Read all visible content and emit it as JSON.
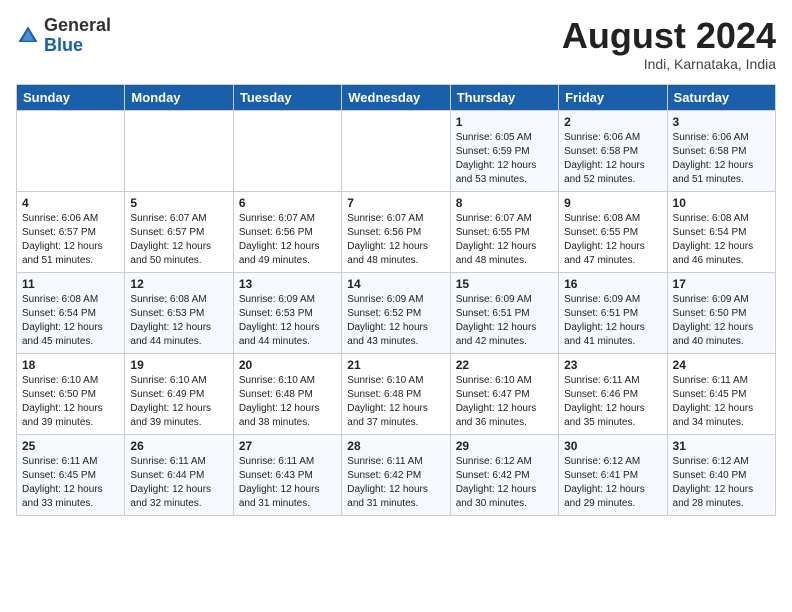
{
  "header": {
    "logo_general": "General",
    "logo_blue": "Blue",
    "month_year": "August 2024",
    "location": "Indi, Karnataka, India"
  },
  "days_of_week": [
    "Sunday",
    "Monday",
    "Tuesday",
    "Wednesday",
    "Thursday",
    "Friday",
    "Saturday"
  ],
  "weeks": [
    [
      {
        "day": "",
        "content": ""
      },
      {
        "day": "",
        "content": ""
      },
      {
        "day": "",
        "content": ""
      },
      {
        "day": "",
        "content": ""
      },
      {
        "day": "1",
        "content": "Sunrise: 6:05 AM\nSunset: 6:59 PM\nDaylight: 12 hours\nand 53 minutes."
      },
      {
        "day": "2",
        "content": "Sunrise: 6:06 AM\nSunset: 6:58 PM\nDaylight: 12 hours\nand 52 minutes."
      },
      {
        "day": "3",
        "content": "Sunrise: 6:06 AM\nSunset: 6:58 PM\nDaylight: 12 hours\nand 51 minutes."
      }
    ],
    [
      {
        "day": "4",
        "content": "Sunrise: 6:06 AM\nSunset: 6:57 PM\nDaylight: 12 hours\nand 51 minutes."
      },
      {
        "day": "5",
        "content": "Sunrise: 6:07 AM\nSunset: 6:57 PM\nDaylight: 12 hours\nand 50 minutes."
      },
      {
        "day": "6",
        "content": "Sunrise: 6:07 AM\nSunset: 6:56 PM\nDaylight: 12 hours\nand 49 minutes."
      },
      {
        "day": "7",
        "content": "Sunrise: 6:07 AM\nSunset: 6:56 PM\nDaylight: 12 hours\nand 48 minutes."
      },
      {
        "day": "8",
        "content": "Sunrise: 6:07 AM\nSunset: 6:55 PM\nDaylight: 12 hours\nand 48 minutes."
      },
      {
        "day": "9",
        "content": "Sunrise: 6:08 AM\nSunset: 6:55 PM\nDaylight: 12 hours\nand 47 minutes."
      },
      {
        "day": "10",
        "content": "Sunrise: 6:08 AM\nSunset: 6:54 PM\nDaylight: 12 hours\nand 46 minutes."
      }
    ],
    [
      {
        "day": "11",
        "content": "Sunrise: 6:08 AM\nSunset: 6:54 PM\nDaylight: 12 hours\nand 45 minutes."
      },
      {
        "day": "12",
        "content": "Sunrise: 6:08 AM\nSunset: 6:53 PM\nDaylight: 12 hours\nand 44 minutes."
      },
      {
        "day": "13",
        "content": "Sunrise: 6:09 AM\nSunset: 6:53 PM\nDaylight: 12 hours\nand 44 minutes."
      },
      {
        "day": "14",
        "content": "Sunrise: 6:09 AM\nSunset: 6:52 PM\nDaylight: 12 hours\nand 43 minutes."
      },
      {
        "day": "15",
        "content": "Sunrise: 6:09 AM\nSunset: 6:51 PM\nDaylight: 12 hours\nand 42 minutes."
      },
      {
        "day": "16",
        "content": "Sunrise: 6:09 AM\nSunset: 6:51 PM\nDaylight: 12 hours\nand 41 minutes."
      },
      {
        "day": "17",
        "content": "Sunrise: 6:09 AM\nSunset: 6:50 PM\nDaylight: 12 hours\nand 40 minutes."
      }
    ],
    [
      {
        "day": "18",
        "content": "Sunrise: 6:10 AM\nSunset: 6:50 PM\nDaylight: 12 hours\nand 39 minutes."
      },
      {
        "day": "19",
        "content": "Sunrise: 6:10 AM\nSunset: 6:49 PM\nDaylight: 12 hours\nand 39 minutes."
      },
      {
        "day": "20",
        "content": "Sunrise: 6:10 AM\nSunset: 6:48 PM\nDaylight: 12 hours\nand 38 minutes."
      },
      {
        "day": "21",
        "content": "Sunrise: 6:10 AM\nSunset: 6:48 PM\nDaylight: 12 hours\nand 37 minutes."
      },
      {
        "day": "22",
        "content": "Sunrise: 6:10 AM\nSunset: 6:47 PM\nDaylight: 12 hours\nand 36 minutes."
      },
      {
        "day": "23",
        "content": "Sunrise: 6:11 AM\nSunset: 6:46 PM\nDaylight: 12 hours\nand 35 minutes."
      },
      {
        "day": "24",
        "content": "Sunrise: 6:11 AM\nSunset: 6:45 PM\nDaylight: 12 hours\nand 34 minutes."
      }
    ],
    [
      {
        "day": "25",
        "content": "Sunrise: 6:11 AM\nSunset: 6:45 PM\nDaylight: 12 hours\nand 33 minutes."
      },
      {
        "day": "26",
        "content": "Sunrise: 6:11 AM\nSunset: 6:44 PM\nDaylight: 12 hours\nand 32 minutes."
      },
      {
        "day": "27",
        "content": "Sunrise: 6:11 AM\nSunset: 6:43 PM\nDaylight: 12 hours\nand 31 minutes."
      },
      {
        "day": "28",
        "content": "Sunrise: 6:11 AM\nSunset: 6:42 PM\nDaylight: 12 hours\nand 31 minutes."
      },
      {
        "day": "29",
        "content": "Sunrise: 6:12 AM\nSunset: 6:42 PM\nDaylight: 12 hours\nand 30 minutes."
      },
      {
        "day": "30",
        "content": "Sunrise: 6:12 AM\nSunset: 6:41 PM\nDaylight: 12 hours\nand 29 minutes."
      },
      {
        "day": "31",
        "content": "Sunrise: 6:12 AM\nSunset: 6:40 PM\nDaylight: 12 hours\nand 28 minutes."
      }
    ]
  ]
}
